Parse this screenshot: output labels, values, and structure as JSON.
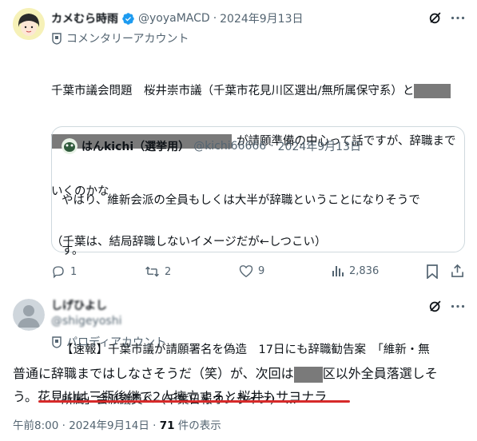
{
  "post1": {
    "display_name": "カメむら時雨",
    "handle": "@yoyaMACD",
    "date": "2024年9月13日",
    "dot": "·",
    "account_type": "コメンタリーアカウント",
    "line1": "千葉市議会問題　桜井崇市議（千葉市花見川区選出/無所属保守系）と",
    "line2_suffix": "が請願準備の中心って話ですが、辞職まで",
    "line3": "いくのかな",
    "line4": "（千葉は、結局辞職しないイメージだが←しつこい）",
    "quote": {
      "display_name": "はんkichi（選挙用）",
      "handle": "@kichi66666",
      "date": "2024年9月13日",
      "dot": "·",
      "line1": "やはり、維新会派の全員もしくは大半が辞職ということになりそうで",
      "line2": "す。",
      "line3": "【速報】千葉市議が請願署名を偽造　17日にも辞職勧告案　「維新・無",
      "line4": "所属」会派議員へ（千葉日報オンライン） ..."
    },
    "actions": {
      "replies": "1",
      "reposts": "2",
      "likes": "9",
      "views": "2,836"
    }
  },
  "post2": {
    "display_name": "しげひよし",
    "handle": "@shigeyoshi",
    "account_type": "パロディアカウント",
    "text_part1": "普通に辞職まではしなさそうだ（笑）が、次回は",
    "text_part2": "区以外全員落選しそ",
    "text_line2": "う。花見川は三瓶後継で2人擁立すると桜井もサヨナラ",
    "timestamp": "午前8:00 · 2024年9月14日 · ",
    "views_count": "71",
    "views_label": " 件の表示"
  },
  "colors": {
    "verified": "#1d9bf0",
    "underline": "#d62a2a",
    "redaction": "#7a7a7a"
  },
  "icons": [
    "verified-icon",
    "grok-icon",
    "more-icon",
    "reply-icon",
    "repost-icon",
    "like-icon",
    "views-icon",
    "bookmark-icon",
    "share-icon",
    "badge-icon"
  ]
}
